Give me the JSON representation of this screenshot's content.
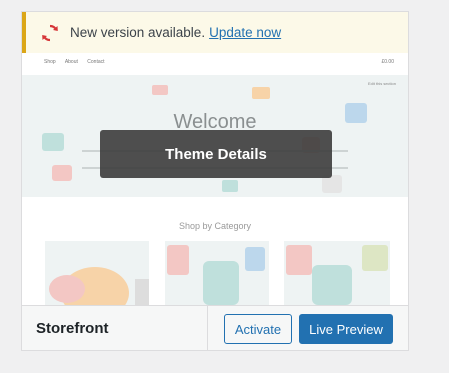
{
  "notice": {
    "message": "New version available.",
    "link": "Update now",
    "icon": "update-icon",
    "accent_color": "#dba617"
  },
  "preview": {
    "nav_left": [
      "Shop",
      "About",
      "Contact"
    ],
    "nav_right": "£0.00",
    "hero_title": "Welcome",
    "hero_tag": "Edit this section",
    "section_title": "Shop by Category"
  },
  "overlay": {
    "label": "Theme Details"
  },
  "theme": {
    "name": "Storefront",
    "activate_label": "Activate",
    "preview_label": "Live Preview",
    "primary_color": "#2271b1"
  }
}
